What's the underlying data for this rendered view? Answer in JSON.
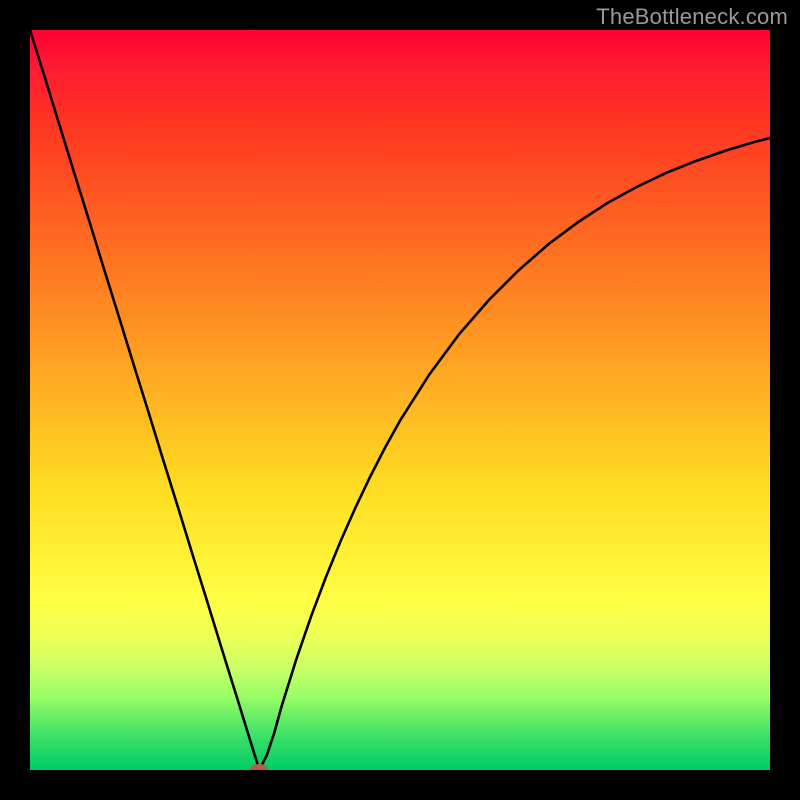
{
  "watermark": "TheBottleneck.com",
  "chart_data": {
    "type": "line",
    "title": "",
    "xlabel": "",
    "ylabel": "",
    "xlim": [
      0,
      100
    ],
    "ylim": [
      0,
      100
    ],
    "grid": false,
    "legend": false,
    "series": [
      {
        "name": "bottleneck-curve",
        "x": [
          0,
          2,
          4,
          6,
          8,
          10,
          12,
          14,
          16,
          18,
          20,
          22,
          24,
          26,
          28,
          30,
          31,
          32,
          33,
          34,
          36,
          38,
          40,
          42,
          44,
          46,
          48,
          50,
          54,
          58,
          62,
          66,
          70,
          74,
          78,
          82,
          86,
          90,
          94,
          98,
          100
        ],
        "y": [
          100,
          93.6,
          87.1,
          80.6,
          74.2,
          67.7,
          61.3,
          54.8,
          48.4,
          41.9,
          35.5,
          29.0,
          22.6,
          16.1,
          9.7,
          3.2,
          0.0,
          2.0,
          5.0,
          8.6,
          15.0,
          20.8,
          26.1,
          31.0,
          35.5,
          39.7,
          43.6,
          47.2,
          53.5,
          58.9,
          63.5,
          67.5,
          71.0,
          74.0,
          76.6,
          78.8,
          80.7,
          82.3,
          83.7,
          84.9,
          85.4
        ]
      }
    ],
    "marker": {
      "x": 31,
      "y": 0,
      "name": "optimal-point"
    },
    "colors": {
      "curve": "#000000",
      "marker": "#b85c4a",
      "gradient_top": "#ff0033",
      "gradient_bottom": "#00cc66"
    }
  }
}
